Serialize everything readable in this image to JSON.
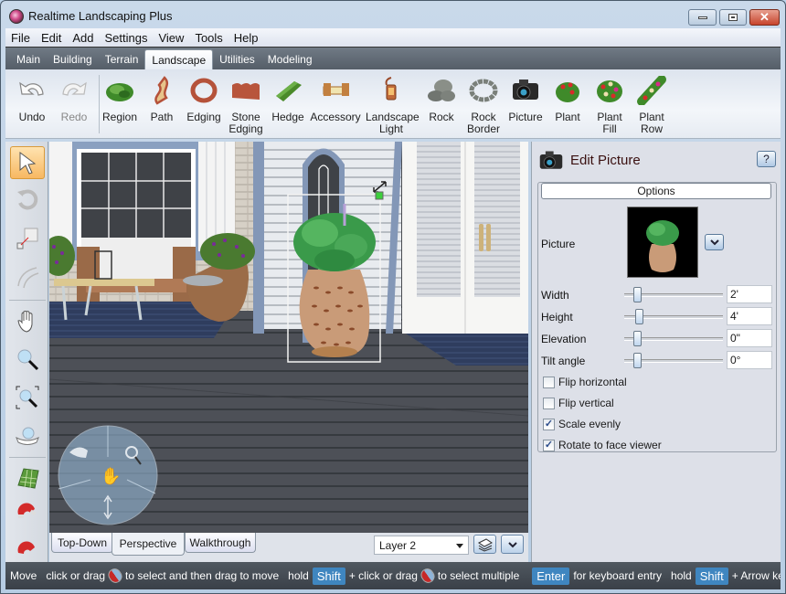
{
  "window": {
    "title": "Realtime Landscaping Plus",
    "controls": [
      "minimize",
      "maximize",
      "close"
    ]
  },
  "menu": [
    "File",
    "Edit",
    "Add",
    "Settings",
    "View",
    "Tools",
    "Help"
  ],
  "ribbon_tabs": [
    {
      "label": "Main",
      "active": false
    },
    {
      "label": "Building",
      "active": false
    },
    {
      "label": "Terrain",
      "active": false
    },
    {
      "label": "Landscape",
      "active": true
    },
    {
      "label": "Utilities",
      "active": false
    },
    {
      "label": "Modeling",
      "active": false
    }
  ],
  "ribbon_buttons": [
    {
      "label": "Undo",
      "icon": "undo-icon",
      "enabled": true
    },
    {
      "label": "Redo",
      "icon": "redo-icon",
      "enabled": false
    },
    {
      "label": "Region",
      "icon": "region-icon",
      "enabled": true
    },
    {
      "label": "Path",
      "icon": "path-icon",
      "enabled": true
    },
    {
      "label": "Edging",
      "icon": "edging-icon",
      "enabled": true
    },
    {
      "label": "Stone Edging",
      "icon": "stone-edging-icon",
      "enabled": true
    },
    {
      "label": "Hedge",
      "icon": "hedge-icon",
      "enabled": true
    },
    {
      "label": "Accessory",
      "icon": "accessory-icon",
      "enabled": true
    },
    {
      "label": "Landscape Light",
      "icon": "landscape-light-icon",
      "enabled": true
    },
    {
      "label": "Rock",
      "icon": "rock-icon",
      "enabled": true
    },
    {
      "label": "Rock Border",
      "icon": "rock-border-icon",
      "enabled": true
    },
    {
      "label": "Picture",
      "icon": "camera-icon",
      "enabled": true
    },
    {
      "label": "Plant",
      "icon": "plant-icon",
      "enabled": true
    },
    {
      "label": "Plant Fill",
      "icon": "plant-fill-icon",
      "enabled": true
    },
    {
      "label": "Plant Row",
      "icon": "plant-row-icon",
      "enabled": true
    }
  ],
  "left_tools": [
    {
      "name": "select-tool",
      "icon": "arrow-cursor-icon",
      "active": true
    },
    {
      "name": "rotate-tool",
      "icon": "rotate-icon",
      "active": false
    },
    {
      "name": "resize-tool",
      "icon": "resize-icon",
      "active": false
    },
    {
      "name": "arc-tool",
      "icon": "arc-icon",
      "active": false
    },
    {
      "name": "pan-tool",
      "icon": "hand-icon",
      "active": false
    },
    {
      "name": "zoom-tool",
      "icon": "magnifier-icon",
      "active": false
    },
    {
      "name": "zoom-extents-tool",
      "icon": "zoom-extents-icon",
      "active": false
    },
    {
      "name": "orbit-tool",
      "icon": "orbit-icon",
      "active": false
    },
    {
      "name": "grid-tool",
      "icon": "grid-icon",
      "active": false
    },
    {
      "name": "snap-tool",
      "icon": "magnet-icon",
      "active": false
    },
    {
      "name": "snap-tool-2",
      "icon": "magnet-icon",
      "active": false
    }
  ],
  "view_tabs": [
    {
      "label": "Top-Down",
      "active": false
    },
    {
      "label": "Perspective",
      "active": true
    },
    {
      "label": "Walkthrough",
      "active": false
    }
  ],
  "layer_select": {
    "value": "Layer 2"
  },
  "edit_panel": {
    "title": "Edit Picture",
    "help_label": "?",
    "options_tab": "Options",
    "picture_label": "Picture",
    "properties": [
      {
        "label": "Width",
        "value": "2'",
        "slider_fraction": 0.1
      },
      {
        "label": "Height",
        "value": "4'",
        "slider_fraction": 0.12
      },
      {
        "label": "Elevation",
        "value": "0\"",
        "slider_fraction": 0.1
      },
      {
        "label": "Tilt angle",
        "value": "0°",
        "slider_fraction": 0.1
      }
    ],
    "checkboxes": [
      {
        "label": "Flip horizontal",
        "checked": false
      },
      {
        "label": "Flip vertical",
        "checked": false
      },
      {
        "label": "Scale evenly",
        "checked": true
      },
      {
        "label": "Rotate to face viewer",
        "checked": true
      }
    ]
  },
  "statusbar": {
    "mode": "Move",
    "hint1_pre": "click or drag",
    "hint1_post": "to select and then drag to move",
    "hold1": "hold",
    "key1": "Shift",
    "hint2_pre": "+ click or drag",
    "hint2_post": "to select multiple",
    "key2": "Enter",
    "hint3": "for keyboard entry",
    "hold2": "hold",
    "key3": "Shift",
    "hint4": "+ Arrow key to nudge"
  },
  "colors": {
    "accent_active_tool": "#f7b862",
    "key_badge": "#3f86c0",
    "statusbar_bg": "#3f454d",
    "selection_handle": "#3ccf3c"
  }
}
